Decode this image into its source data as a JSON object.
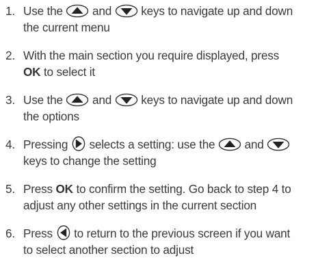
{
  "steps": [
    {
      "number": "1.",
      "line1_a": "Use the",
      "line1_b": "and",
      "line1_c": "keys to navigate up and down",
      "line2": "the current menu",
      "keys": [
        "up-arrow-key-icon",
        "down-arrow-key-icon"
      ]
    },
    {
      "number": "2.",
      "line1": "With the main section you require displayed, press",
      "line2_bold": "OK",
      "line2_rest": "to select it"
    },
    {
      "number": "3.",
      "line1_a": "Use the",
      "line1_b": "and",
      "line1_c": "keys to navigate up and down",
      "line2": "the options",
      "keys": [
        "up-arrow-key-icon",
        "down-arrow-key-icon"
      ]
    },
    {
      "number": "4.",
      "line1_a": "Pressing",
      "line1_b": "selects a setting: use the",
      "line1_c": "and",
      "line2": "keys to change the setting",
      "keys": [
        "right-arrow-key-icon",
        "up-arrow-key-icon",
        "down-arrow-key-icon"
      ]
    },
    {
      "number": "5.",
      "line1_a": "Press",
      "line1_bold": "OK",
      "line1_b": "to confirm the setting. Go back to step 4 to",
      "line2": "adjust any other settings in the current section"
    },
    {
      "number": "6.",
      "line1_a": "Press",
      "line1_b": "to return to the previous screen if you want",
      "line2": "to select another section to adjust",
      "keys": [
        "left-arrow-key-icon"
      ]
    }
  ],
  "colors": {
    "text": "#3a3a3a",
    "key_stroke": "#333333"
  }
}
